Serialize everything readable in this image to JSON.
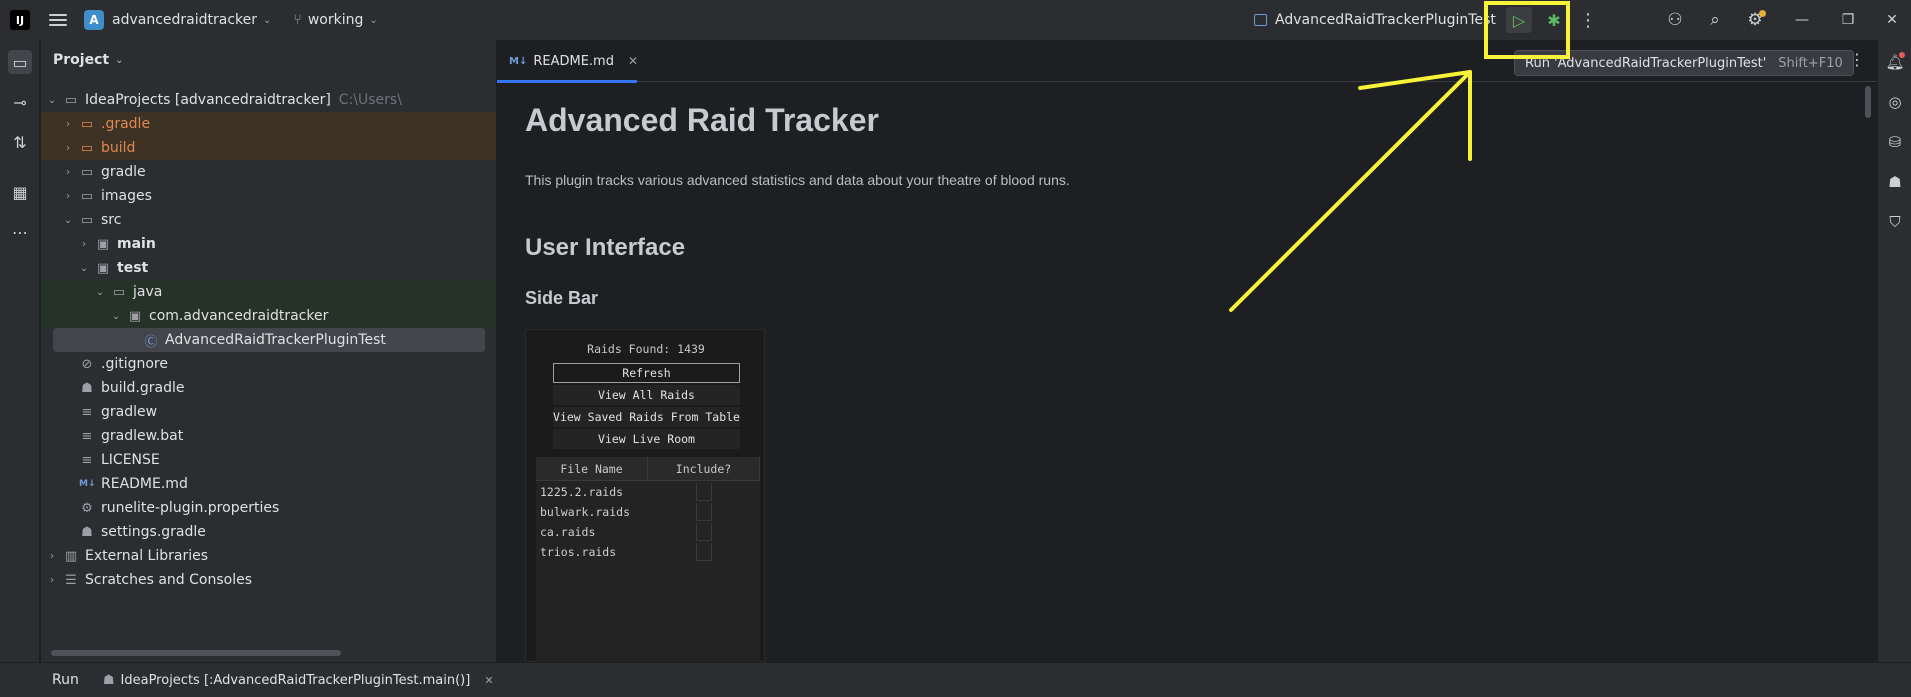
{
  "topbar": {
    "logo": "IJ",
    "project_badge": "A",
    "project_name": "advancedraidtracker",
    "branch": "working",
    "run_config": "AdvancedRaidTrackerPluginTest"
  },
  "project_panel": {
    "title": "Project",
    "tree": [
      {
        "label": "IdeaProjects [advancedraidtracker]",
        "hint": "C:\\Users\\",
        "icon": "folder-module-icon",
        "depth": 0,
        "arrow": "open",
        "style": "normal"
      },
      {
        "label": ".gradle",
        "icon": "folder-icon",
        "depth": 1,
        "arrow": "closed",
        "style": "excluded"
      },
      {
        "label": "build",
        "icon": "folder-icon",
        "depth": 1,
        "arrow": "closed",
        "style": "excluded"
      },
      {
        "label": "gradle",
        "icon": "folder-icon",
        "depth": 1,
        "arrow": "closed",
        "style": "normal"
      },
      {
        "label": "images",
        "icon": "folder-icon",
        "depth": 1,
        "arrow": "closed",
        "style": "normal"
      },
      {
        "label": "src",
        "icon": "folder-icon",
        "depth": 1,
        "arrow": "open",
        "style": "normal"
      },
      {
        "label": "main",
        "icon": "source-folder-icon",
        "depth": 2,
        "arrow": "closed",
        "style": "bold"
      },
      {
        "label": "test",
        "icon": "test-folder-icon",
        "depth": 2,
        "arrow": "open",
        "style": "bold"
      },
      {
        "label": "java",
        "icon": "folder-icon",
        "depth": 3,
        "arrow": "open",
        "style": "test"
      },
      {
        "label": "com.advancedraidtracker",
        "icon": "package-icon",
        "depth": 4,
        "arrow": "open",
        "style": "test"
      },
      {
        "label": "AdvancedRaidTrackerPluginTest",
        "icon": "class-icon",
        "depth": 5,
        "arrow": "none",
        "style": "selected"
      },
      {
        "label": ".gitignore",
        "icon": "ignore-file-icon",
        "depth": 1,
        "arrow": "none",
        "style": "normal"
      },
      {
        "label": "build.gradle",
        "icon": "gradle-icon",
        "depth": 1,
        "arrow": "none",
        "style": "normal"
      },
      {
        "label": "gradlew",
        "icon": "text-file-icon",
        "depth": 1,
        "arrow": "none",
        "style": "normal"
      },
      {
        "label": "gradlew.bat",
        "icon": "text-file-icon",
        "depth": 1,
        "arrow": "none",
        "style": "normal"
      },
      {
        "label": "LICENSE",
        "icon": "text-file-icon",
        "depth": 1,
        "arrow": "none",
        "style": "normal"
      },
      {
        "label": "README.md",
        "icon": "markdown-icon",
        "depth": 1,
        "arrow": "none",
        "style": "normal"
      },
      {
        "label": "runelite-plugin.properties",
        "icon": "settings-file-icon",
        "depth": 1,
        "arrow": "none",
        "style": "normal"
      },
      {
        "label": "settings.gradle",
        "icon": "gradle-icon",
        "depth": 1,
        "arrow": "none",
        "style": "normal"
      },
      {
        "label": "External Libraries",
        "icon": "library-icon",
        "depth": 0,
        "arrow": "closed",
        "style": "normal"
      },
      {
        "label": "Scratches and Consoles",
        "icon": "scratches-icon",
        "depth": 0,
        "arrow": "closed",
        "style": "normal"
      }
    ]
  },
  "editor": {
    "tab_badge": "M↓",
    "tab_label": "README.md",
    "tooltip_text": "Run 'AdvancedRaidTrackerPluginTest'",
    "tooltip_shortcut": "Shift+F10",
    "doc": {
      "h1": "Advanced Raid Tracker",
      "para": "This plugin tracks various advanced statistics and data about your theatre of blood runs.",
      "h2": "User Interface",
      "h3": "Side Bar"
    },
    "sidebar_image": {
      "raids_found": "Raids Found: 1439",
      "buttons": [
        "Refresh",
        "View All Raids",
        "View Saved Raids From Table",
        "View Live Room"
      ],
      "table_headers": [
        "File Name",
        "Include?"
      ],
      "files": [
        "1225.2.raids",
        "bulwark.raids",
        "ca.raids",
        "trios.raids"
      ]
    }
  },
  "bottombar": {
    "run_label": "Run",
    "run_tab": "IdeaProjects [:AdvancedRaidTrackerPluginTest.main()]"
  },
  "colors": {
    "annotation": "#f7f339",
    "accent": "#3574f0",
    "run_green": "#5fb865"
  }
}
